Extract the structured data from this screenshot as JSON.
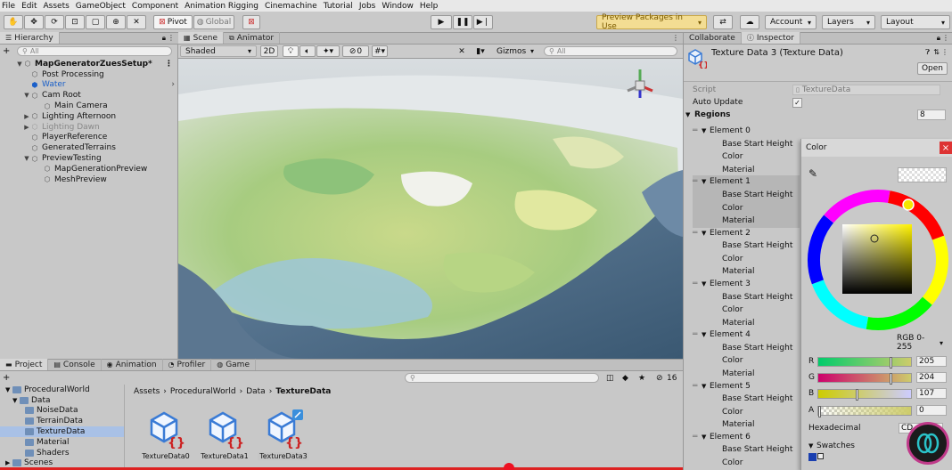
{
  "menu": [
    "File",
    "Edit",
    "Assets",
    "GameObject",
    "Component",
    "Animation Rigging",
    "Cinemachine",
    "Tutorial",
    "Jobs",
    "Window",
    "Help"
  ],
  "toolbar": {
    "pivot": "Pivot",
    "global": "Global",
    "preview_packages": "Preview Packages in Use",
    "account": "Account",
    "layers": "Layers",
    "layout": "Layout"
  },
  "hierarchy": {
    "tab": "Hierarchy",
    "add": "+",
    "search_placeholder": "All",
    "items": [
      {
        "label": "MapGeneratorZuesSetup*"
      },
      {
        "label": "Post Processing"
      },
      {
        "label": "Water"
      },
      {
        "label": "Cam Root"
      },
      {
        "label": "Main Camera"
      },
      {
        "label": "Lighting Afternoon"
      },
      {
        "label": "Lighting Dawn"
      },
      {
        "label": "PlayerReference"
      },
      {
        "label": "GeneratedTerrains"
      },
      {
        "label": "PreviewTesting"
      },
      {
        "label": "MapGenerationPreview"
      },
      {
        "label": "MeshPreview"
      }
    ]
  },
  "scene": {
    "tabs": [
      "Scene",
      "Animator"
    ],
    "shading": "Shaded",
    "mode2d": "2D",
    "hidden_count": "0",
    "gizmos": "Gizmos",
    "search_placeholder": "All"
  },
  "inspector": {
    "tabs": [
      "Collaborate",
      "Inspector"
    ],
    "title": "Texture Data 3 (Texture Data)",
    "open_button": "Open",
    "script_label": "Script",
    "script_value": "TextureData",
    "auto_update_label": "Auto Update",
    "auto_update_check": "✓",
    "regions_label": "Regions",
    "regions_count": "8",
    "field_labels": [
      "Base Start Height",
      "Color",
      "Material"
    ],
    "elements": [
      {
        "name": "Element 0"
      },
      {
        "name": "Element 1"
      },
      {
        "name": "Element 2"
      },
      {
        "name": "Element 3"
      },
      {
        "name": "Element 4"
      },
      {
        "name": "Element 5"
      },
      {
        "name": "Element 6"
      }
    ]
  },
  "color_picker": {
    "title": "Color",
    "close": "×",
    "mode": "RGB 0-255",
    "channels": [
      {
        "label": "R",
        "value": "205",
        "fraction": 0.8
      },
      {
        "label": "G",
        "value": "204",
        "fraction": 0.8
      },
      {
        "label": "B",
        "value": "107",
        "fraction": 0.42
      },
      {
        "label": "A",
        "value": "0",
        "fraction": 0.0
      }
    ],
    "hex_label": "Hexadecimal",
    "hex_value": "CD",
    "swatches_label": "Swatches",
    "selected_color": "#CDCC6B"
  },
  "project": {
    "tabs": [
      "Project",
      "Console",
      "Animation",
      "Profiler",
      "Game"
    ],
    "add": "+",
    "icon_count": "16",
    "breadcrumb": [
      "Assets",
      "ProceduralWorld",
      "Data",
      "TextureData"
    ],
    "tree": [
      {
        "label": "ProceduralWorld"
      },
      {
        "label": "Data"
      },
      {
        "label": "NoiseData"
      },
      {
        "label": "TerrainData"
      },
      {
        "label": "TextureData"
      },
      {
        "label": "Material"
      },
      {
        "label": "Shaders"
      },
      {
        "label": "Scenes"
      }
    ],
    "assets": [
      "TextureData0",
      "TextureData1",
      "TextureData3"
    ]
  }
}
